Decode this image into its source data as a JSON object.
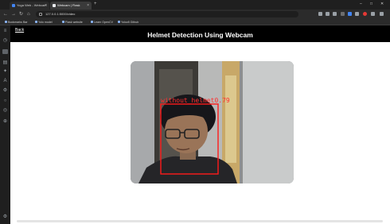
{
  "browser": {
    "tabs": [
      {
        "label": "Yoga Web - Webcam"
      },
      {
        "label": "Webcam | Flask"
      }
    ],
    "window_controls": [
      "–",
      "□",
      "✕"
    ],
    "address": {
      "url": "127.0.0.1:5000/video"
    },
    "bookmarks": [
      {
        "label": "Bookmarks Bar"
      },
      {
        "label": "Yolo model"
      },
      {
        "label": "Flask website"
      },
      {
        "label": "Learn OpenCV"
      },
      {
        "label": "Yolov8 Github"
      }
    ],
    "colors": {
      "accent": "#8ab4f8"
    }
  },
  "page": {
    "back_label": "Back",
    "title": "Helmet Detection Using Webcam"
  },
  "video": {
    "detection": {
      "label": "without_helmet",
      "confidence": "0.79",
      "box_color": "#ff1a1a"
    }
  }
}
